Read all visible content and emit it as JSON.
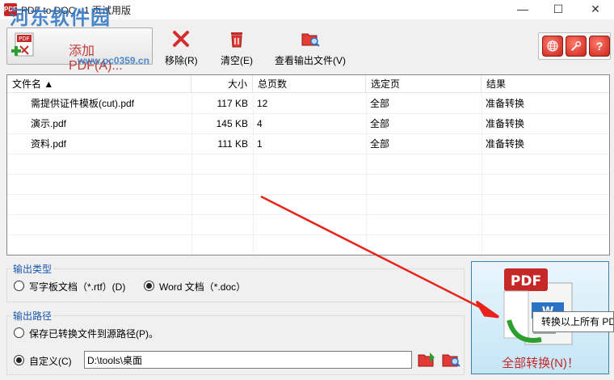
{
  "window": {
    "title": "PDF to DOC - 1 页试用版",
    "watermark": "河东软件园",
    "watermark_url": "www.pc0359.cn",
    "minimize": "—",
    "maximize": "☐",
    "close": "✕"
  },
  "toolbar": {
    "add_label": "添加 PDF(A)...",
    "remove_label": "移除(R)",
    "clear_label": "清空(E)",
    "view_output_label": "查看输出文件(V)",
    "globe_icon": "globe-icon",
    "wrench_icon": "wrench-icon",
    "help_label": "?"
  },
  "table": {
    "headers": [
      "文件名 ▲",
      "大小",
      "总页数",
      "选定页",
      "结果"
    ],
    "rows": [
      {
        "name": "需提供证件模板(cut).pdf",
        "size": "117 KB",
        "pages": "12",
        "selected": "全部",
        "result": "准备转换"
      },
      {
        "name": "演示.pdf",
        "size": "145 KB",
        "pages": "4",
        "selected": "全部",
        "result": "准备转换"
      },
      {
        "name": "资料.pdf",
        "size": "111 KB",
        "pages": "1",
        "selected": "全部",
        "result": "准备转换"
      }
    ]
  },
  "output_type": {
    "title": "输出类型",
    "option_rtf": "写字板文档（*.rtf）(D)",
    "option_doc": "Word 文档（*.doc）",
    "selected": "doc"
  },
  "output_path": {
    "title": "输出路径",
    "option_source": "保存已转换文件到源路径(P)。",
    "option_custom": "自定义(C)",
    "custom_value": "D:\\tools\\桌面",
    "selected": "custom"
  },
  "convert": {
    "label": "全部转换(N)！",
    "tooltip": "转换以上所有 PDF"
  },
  "colors": {
    "accent_red": "#c62828",
    "link_blue": "#1a56b0",
    "arrow_red": "#e8231c"
  }
}
